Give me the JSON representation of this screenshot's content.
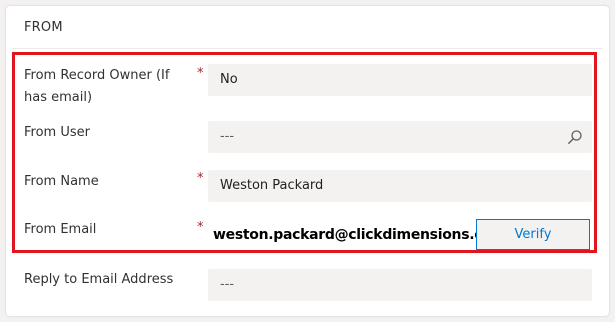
{
  "section": {
    "title": "FROM"
  },
  "fields": {
    "record_owner": {
      "label": "From Record Owner (If has email)",
      "required": "*",
      "value": "No"
    },
    "user": {
      "label": "From User",
      "value": "---",
      "icon": "search-icon"
    },
    "name": {
      "label": "From Name",
      "required": "*",
      "value": "Weston Packard"
    },
    "email": {
      "label": "From Email",
      "required": "*",
      "value": "weston.packard@clickdimensions.com",
      "verify_label": "Verify"
    },
    "reply_to": {
      "label": "Reply to Email Address",
      "value": "---"
    }
  },
  "colors": {
    "highlight": "#e0151e",
    "accent": "#0078d4",
    "required": "#a4262c"
  }
}
